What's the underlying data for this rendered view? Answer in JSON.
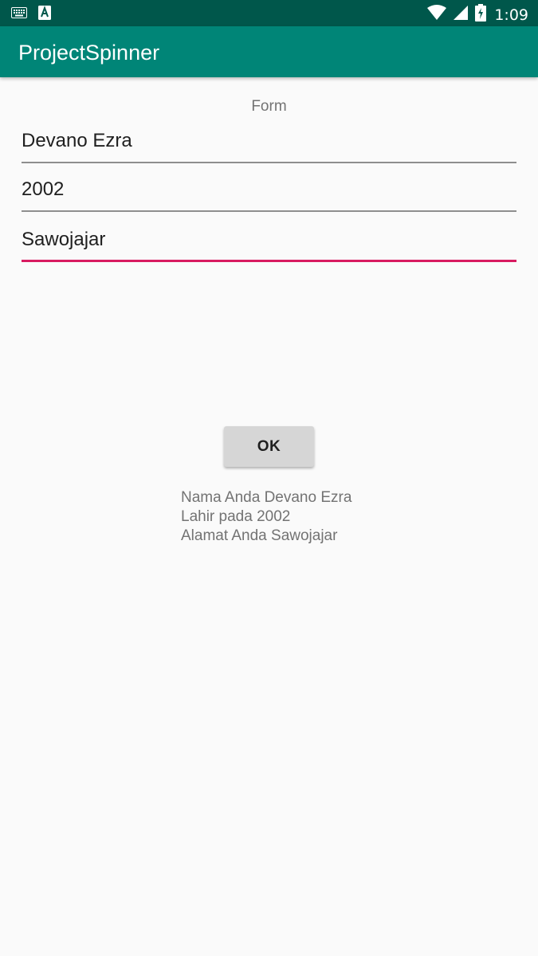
{
  "status_bar": {
    "time": "1:09",
    "icons": [
      "keyboard-icon",
      "a-badge-icon",
      "wifi-icon",
      "signal-icon",
      "battery-icon"
    ]
  },
  "app_bar": {
    "title": "ProjectSpinner",
    "color": "#008577"
  },
  "form": {
    "label": "Form",
    "name_value": "Devano Ezra",
    "year_value": "2002",
    "address_value": "Sawojajar",
    "focused_underline_color": "#d81b60"
  },
  "ok_button": {
    "label": "OK"
  },
  "result": {
    "line1": "Nama Anda Devano Ezra",
    "line2": "Lahir pada 2002",
    "line3": "Alamat Anda Sawojajar"
  }
}
